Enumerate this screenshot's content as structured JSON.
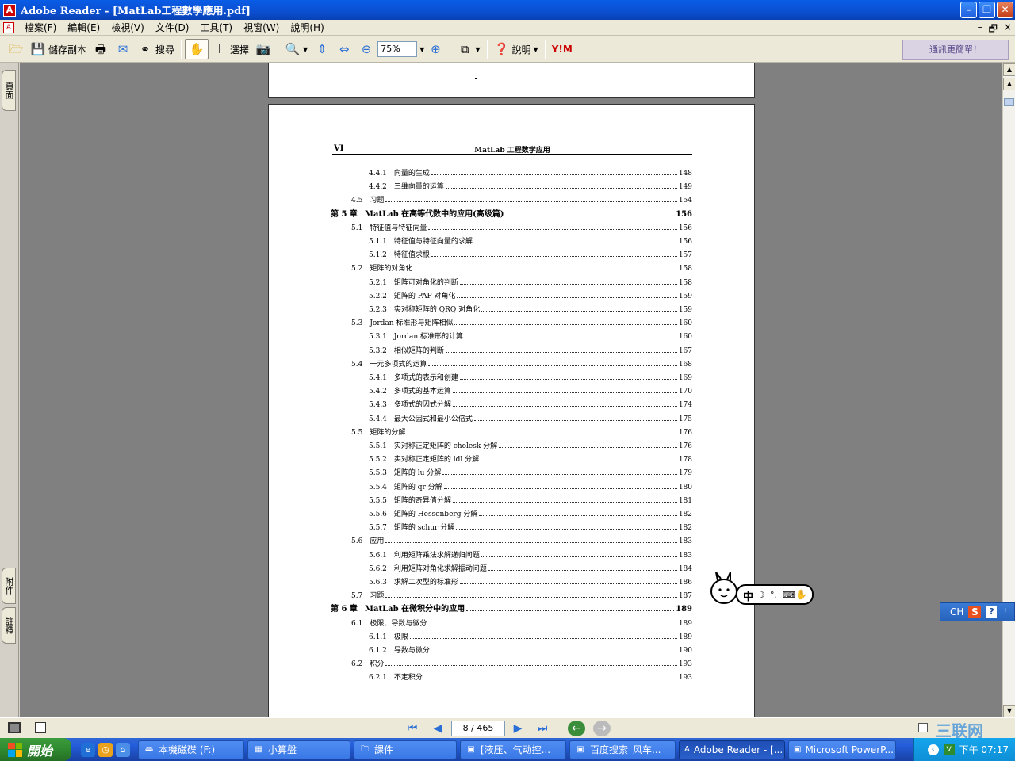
{
  "window": {
    "title": "Adobe Reader - [MatLab工程數學應用.pdf]"
  },
  "menubar": {
    "items": [
      "檔案(F)",
      "編輯(E)",
      "檢視(V)",
      "文件(D)",
      "工具(T)",
      "視窗(W)",
      "說明(H)"
    ],
    "right_controls": [
      "–",
      "🗗",
      "×"
    ]
  },
  "toolbar": {
    "save_copy_label": "儲存副本",
    "search_label": "搜尋",
    "select_label": "選擇",
    "zoom_value": "75%",
    "help_label": "說明",
    "yahoo_label": "Y!M",
    "promo_text": "通訊更簡單！"
  },
  "sidebar": {
    "tab_pages": "頁面",
    "tab_attachments": "附件",
    "tab_comments": "註釋"
  },
  "document": {
    "running_head_page": "VI",
    "running_head_title": "MatLab 工程数学应用",
    "toc": [
      {
        "num": "4.4.1",
        "title": "向量的生成",
        "page": "148",
        "level": 2
      },
      {
        "num": "4.4.2",
        "title": "三维向量的运算",
        "page": "149",
        "level": 2
      },
      {
        "num": "4.5",
        "title": "习题",
        "page": "154",
        "level": 1
      },
      {
        "num": "第 5 章",
        "title": "MatLab 在高等代数中的应用(高级篇)",
        "page": "156",
        "level": 0
      },
      {
        "num": "5.1",
        "title": "特征值与特征向量",
        "page": "156",
        "level": 1
      },
      {
        "num": "5.1.1",
        "title": "特征值与特征向量的求解",
        "page": "156",
        "level": 2
      },
      {
        "num": "5.1.2",
        "title": "特征值求根",
        "page": "157",
        "level": 2
      },
      {
        "num": "5.2",
        "title": "矩阵的对角化",
        "page": "158",
        "level": 1
      },
      {
        "num": "5.2.1",
        "title": "矩阵可对角化的判断",
        "page": "158",
        "level": 2
      },
      {
        "num": "5.2.2",
        "title": "矩阵的 PAP 对角化",
        "page": "159",
        "level": 2
      },
      {
        "num": "5.2.3",
        "title": "实对称矩阵的 QRQ 对角化",
        "page": "159",
        "level": 2
      },
      {
        "num": "5.3",
        "title": "Jordan 标准形与矩阵相似",
        "page": "160",
        "level": 1
      },
      {
        "num": "5.3.1",
        "title": "Jordan 标准形的计算",
        "page": "160",
        "level": 2
      },
      {
        "num": "5.3.2",
        "title": "相似矩阵的判断",
        "page": "167",
        "level": 2
      },
      {
        "num": "5.4",
        "title": "一元多项式的运算",
        "page": "168",
        "level": 1
      },
      {
        "num": "5.4.1",
        "title": "多项式的表示和创建",
        "page": "169",
        "level": 2
      },
      {
        "num": "5.4.2",
        "title": "多项式的基本运算",
        "page": "170",
        "level": 2
      },
      {
        "num": "5.4.3",
        "title": "多项式的因式分解",
        "page": "174",
        "level": 2
      },
      {
        "num": "5.4.4",
        "title": "最大公因式和最小公倍式",
        "page": "175",
        "level": 2
      },
      {
        "num": "5.5",
        "title": "矩阵的分解",
        "page": "176",
        "level": 1
      },
      {
        "num": "5.5.1",
        "title": "实对称正定矩阵的 cholesk 分解",
        "page": "176",
        "level": 2
      },
      {
        "num": "5.5.2",
        "title": "实对称正定矩阵的 ldl 分解",
        "page": "178",
        "level": 2
      },
      {
        "num": "5.5.3",
        "title": "矩阵的 lu 分解",
        "page": "179",
        "level": 2
      },
      {
        "num": "5.5.4",
        "title": "矩阵的 qr 分解",
        "page": "180",
        "level": 2
      },
      {
        "num": "5.5.5",
        "title": "矩阵的奇异值分解",
        "page": "181",
        "level": 2
      },
      {
        "num": "5.5.6",
        "title": "矩阵的 Hessenberg 分解",
        "page": "182",
        "level": 2
      },
      {
        "num": "5.5.7",
        "title": "矩阵的 schur 分解",
        "page": "182",
        "level": 2
      },
      {
        "num": "5.6",
        "title": "应用",
        "page": "183",
        "level": 1
      },
      {
        "num": "5.6.1",
        "title": "利用矩阵乘法求解递归问题",
        "page": "183",
        "level": 2
      },
      {
        "num": "5.6.2",
        "title": "利用矩阵对角化求解振动问题",
        "page": "184",
        "level": 2
      },
      {
        "num": "5.6.3",
        "title": "求解二次型的标准形",
        "page": "186",
        "level": 2
      },
      {
        "num": "5.7",
        "title": "习题",
        "page": "187",
        "level": 1
      },
      {
        "num": "第 6 章",
        "title": "MatLab 在微积分中的应用",
        "page": "189",
        "level": 0
      },
      {
        "num": "6.1",
        "title": "极限、导数与微分",
        "page": "189",
        "level": 1
      },
      {
        "num": "6.1.1",
        "title": "极限",
        "page": "189",
        "level": 2
      },
      {
        "num": "6.1.2",
        "title": "导数与微分",
        "page": "190",
        "level": 2
      },
      {
        "num": "6.2",
        "title": "积分",
        "page": "193",
        "level": 1
      },
      {
        "num": "6.2.1",
        "title": "不定积分",
        "page": "193",
        "level": 2
      }
    ]
  },
  "mascot": {
    "ime_text": "中"
  },
  "ime_bar": {
    "lang": "CH"
  },
  "statusbar": {
    "page_indicator": "8 / 465"
  },
  "taskbar": {
    "start_label": "開始",
    "tasks": [
      {
        "label": "本機磁碟 (F:)",
        "active": false
      },
      {
        "label": "小算盤",
        "active": false
      },
      {
        "label": "課件",
        "active": false
      },
      {
        "label": "[液压、气动控...",
        "active": false
      },
      {
        "label": "百度搜索_风车...",
        "active": false
      },
      {
        "label": "Adobe Reader - [...",
        "active": true
      },
      {
        "label": "Microsoft PowerP...",
        "active": false
      }
    ],
    "clock": "下午 07:17"
  },
  "watermark": "三联网",
  "colors": {
    "titlebar": "#0b4fd0",
    "taskbar": "#245edb",
    "start": "#2f8a2f",
    "doc_bg": "#808080"
  }
}
